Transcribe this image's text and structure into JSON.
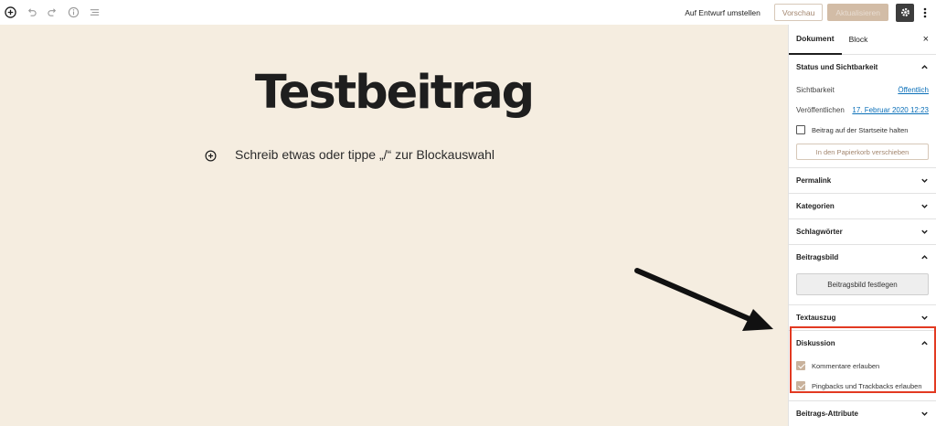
{
  "toolbar": {
    "icons": [
      "add-block-icon",
      "undo-icon",
      "redo-icon",
      "info-icon",
      "list-view-icon"
    ],
    "draft_label": "Auf Entwurf umstellen",
    "preview_label": "Vorschau",
    "update_label": "Aktualisieren",
    "settings_icon": "gear-icon",
    "more_icon": "more-vertical-icon"
  },
  "editor": {
    "title": "Testbeitrag",
    "placeholder": "Schreib etwas oder tippe „/“ zur Blockauswahl",
    "background": "#f5ede0"
  },
  "sidebar": {
    "tabs": [
      {
        "label": "Dokument",
        "active": true
      },
      {
        "label": "Block",
        "active": false
      }
    ],
    "close": "×",
    "status": {
      "title": "Status und Sichtbarkeit",
      "visibility_label": "Sichtbarkeit",
      "visibility_value": "Öffentlich",
      "publish_label": "Veröffentlichen",
      "publish_value": "17. Februar 2020 12:23",
      "sticky_label": "Beitrag auf der Startseite halten",
      "trash_label": "In den Papierkorb verschieben"
    },
    "permalink": "Permalink",
    "categories": "Kategorien",
    "tags": "Schlagwörter",
    "featured": {
      "title": "Beitragsbild",
      "button": "Beitragsbild festlegen"
    },
    "excerpt": "Textauszug",
    "discussion": {
      "title": "Diskussion",
      "comments_label": "Kommentare erlauben",
      "pingbacks_label": "Pingbacks und Trackbacks erlauben",
      "comments_checked": true,
      "pingbacks_checked": true
    },
    "attributes": "Beitrags-Attribute"
  },
  "colors": {
    "accent": "#a3866f",
    "link": "#0a6fb8",
    "highlight_border": "#e23a22"
  }
}
